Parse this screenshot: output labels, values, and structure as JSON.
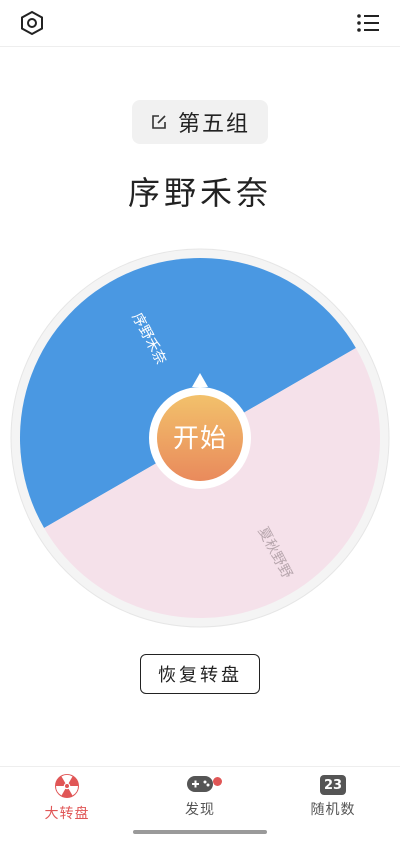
{
  "header": {
    "settings_icon": "hexagon-gear-icon",
    "menu_icon": "list-icon"
  },
  "group": {
    "label": "第五组",
    "edit_icon": "edit-icon"
  },
  "title": "序野禾奈",
  "wheel": {
    "segments": [
      {
        "label": "序野禾奈",
        "color": "#4a98e2",
        "text_color": "#ffffff"
      },
      {
        "label": "夏秋野野",
        "color": "#f5e1ea",
        "text_color": "#b8a7ae"
      }
    ],
    "ring_color": "#f4f4f4",
    "start_label": "开始",
    "start_gradient": [
      "#f2c16b",
      "#e98a5c"
    ]
  },
  "restore_label": "恢复转盘",
  "nav": {
    "items": [
      {
        "label": "大转盘",
        "icon": "radiation-wheel-icon",
        "active": true
      },
      {
        "label": "发现",
        "icon": "gamepad-icon",
        "has_badge": true
      },
      {
        "label": "随机数",
        "icon": "calendar-number-icon",
        "icon_text": "23"
      }
    ],
    "active_color": "#e05656",
    "inactive_color": "#555555",
    "badge_color": "#e05656"
  }
}
